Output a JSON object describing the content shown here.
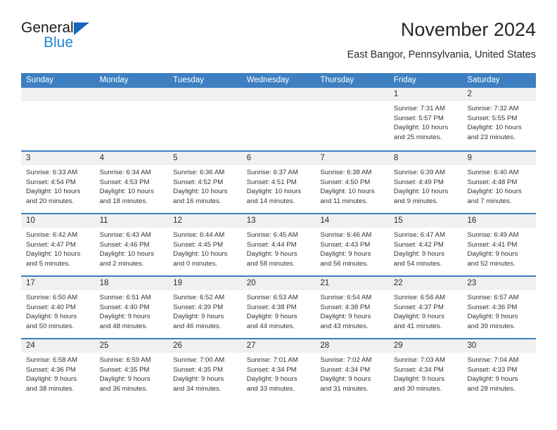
{
  "brand": {
    "name_part1": "General",
    "name_part2": "Blue",
    "triangle_color": "#1567b8",
    "blue_text_color": "#1f86d8"
  },
  "header": {
    "title": "November 2024",
    "subtitle": "East Bangor, Pennsylvania, United States"
  },
  "colors": {
    "header_blue": "#3d7fc1",
    "daynum_band": "#f0f0f0",
    "text": "#333333"
  },
  "weekdays": [
    "Sunday",
    "Monday",
    "Tuesday",
    "Wednesday",
    "Thursday",
    "Friday",
    "Saturday"
  ],
  "weeks": [
    {
      "days": [
        {
          "empty": true
        },
        {
          "empty": true
        },
        {
          "empty": true
        },
        {
          "empty": true
        },
        {
          "empty": true
        },
        {
          "empty": false,
          "num": "1",
          "sunrise": "Sunrise: 7:31 AM",
          "sunset": "Sunset: 5:57 PM",
          "daylight": "Daylight: 10 hours and 25 minutes."
        },
        {
          "empty": false,
          "num": "2",
          "sunrise": "Sunrise: 7:32 AM",
          "sunset": "Sunset: 5:55 PM",
          "daylight": "Daylight: 10 hours and 23 minutes."
        }
      ]
    },
    {
      "days": [
        {
          "empty": false,
          "num": "3",
          "sunrise": "Sunrise: 6:33 AM",
          "sunset": "Sunset: 4:54 PM",
          "daylight": "Daylight: 10 hours and 20 minutes."
        },
        {
          "empty": false,
          "num": "4",
          "sunrise": "Sunrise: 6:34 AM",
          "sunset": "Sunset: 4:53 PM",
          "daylight": "Daylight: 10 hours and 18 minutes."
        },
        {
          "empty": false,
          "num": "5",
          "sunrise": "Sunrise: 6:36 AM",
          "sunset": "Sunset: 4:52 PM",
          "daylight": "Daylight: 10 hours and 16 minutes."
        },
        {
          "empty": false,
          "num": "6",
          "sunrise": "Sunrise: 6:37 AM",
          "sunset": "Sunset: 4:51 PM",
          "daylight": "Daylight: 10 hours and 14 minutes."
        },
        {
          "empty": false,
          "num": "7",
          "sunrise": "Sunrise: 6:38 AM",
          "sunset": "Sunset: 4:50 PM",
          "daylight": "Daylight: 10 hours and 11 minutes."
        },
        {
          "empty": false,
          "num": "8",
          "sunrise": "Sunrise: 6:39 AM",
          "sunset": "Sunset: 4:49 PM",
          "daylight": "Daylight: 10 hours and 9 minutes."
        },
        {
          "empty": false,
          "num": "9",
          "sunrise": "Sunrise: 6:40 AM",
          "sunset": "Sunset: 4:48 PM",
          "daylight": "Daylight: 10 hours and 7 minutes."
        }
      ]
    },
    {
      "days": [
        {
          "empty": false,
          "num": "10",
          "sunrise": "Sunrise: 6:42 AM",
          "sunset": "Sunset: 4:47 PM",
          "daylight": "Daylight: 10 hours and 5 minutes."
        },
        {
          "empty": false,
          "num": "11",
          "sunrise": "Sunrise: 6:43 AM",
          "sunset": "Sunset: 4:46 PM",
          "daylight": "Daylight: 10 hours and 2 minutes."
        },
        {
          "empty": false,
          "num": "12",
          "sunrise": "Sunrise: 6:44 AM",
          "sunset": "Sunset: 4:45 PM",
          "daylight": "Daylight: 10 hours and 0 minutes."
        },
        {
          "empty": false,
          "num": "13",
          "sunrise": "Sunrise: 6:45 AM",
          "sunset": "Sunset: 4:44 PM",
          "daylight": "Daylight: 9 hours and 58 minutes."
        },
        {
          "empty": false,
          "num": "14",
          "sunrise": "Sunrise: 6:46 AM",
          "sunset": "Sunset: 4:43 PM",
          "daylight": "Daylight: 9 hours and 56 minutes."
        },
        {
          "empty": false,
          "num": "15",
          "sunrise": "Sunrise: 6:47 AM",
          "sunset": "Sunset: 4:42 PM",
          "daylight": "Daylight: 9 hours and 54 minutes."
        },
        {
          "empty": false,
          "num": "16",
          "sunrise": "Sunrise: 6:49 AM",
          "sunset": "Sunset: 4:41 PM",
          "daylight": "Daylight: 9 hours and 52 minutes."
        }
      ]
    },
    {
      "days": [
        {
          "empty": false,
          "num": "17",
          "sunrise": "Sunrise: 6:50 AM",
          "sunset": "Sunset: 4:40 PM",
          "daylight": "Daylight: 9 hours and 50 minutes."
        },
        {
          "empty": false,
          "num": "18",
          "sunrise": "Sunrise: 6:51 AM",
          "sunset": "Sunset: 4:40 PM",
          "daylight": "Daylight: 9 hours and 48 minutes."
        },
        {
          "empty": false,
          "num": "19",
          "sunrise": "Sunrise: 6:52 AM",
          "sunset": "Sunset: 4:39 PM",
          "daylight": "Daylight: 9 hours and 46 minutes."
        },
        {
          "empty": false,
          "num": "20",
          "sunrise": "Sunrise: 6:53 AM",
          "sunset": "Sunset: 4:38 PM",
          "daylight": "Daylight: 9 hours and 44 minutes."
        },
        {
          "empty": false,
          "num": "21",
          "sunrise": "Sunrise: 6:54 AM",
          "sunset": "Sunset: 4:38 PM",
          "daylight": "Daylight: 9 hours and 43 minutes."
        },
        {
          "empty": false,
          "num": "22",
          "sunrise": "Sunrise: 6:56 AM",
          "sunset": "Sunset: 4:37 PM",
          "daylight": "Daylight: 9 hours and 41 minutes."
        },
        {
          "empty": false,
          "num": "23",
          "sunrise": "Sunrise: 6:57 AM",
          "sunset": "Sunset: 4:36 PM",
          "daylight": "Daylight: 9 hours and 39 minutes."
        }
      ]
    },
    {
      "days": [
        {
          "empty": false,
          "num": "24",
          "sunrise": "Sunrise: 6:58 AM",
          "sunset": "Sunset: 4:36 PM",
          "daylight": "Daylight: 9 hours and 38 minutes."
        },
        {
          "empty": false,
          "num": "25",
          "sunrise": "Sunrise: 6:59 AM",
          "sunset": "Sunset: 4:35 PM",
          "daylight": "Daylight: 9 hours and 36 minutes."
        },
        {
          "empty": false,
          "num": "26",
          "sunrise": "Sunrise: 7:00 AM",
          "sunset": "Sunset: 4:35 PM",
          "daylight": "Daylight: 9 hours and 34 minutes."
        },
        {
          "empty": false,
          "num": "27",
          "sunrise": "Sunrise: 7:01 AM",
          "sunset": "Sunset: 4:34 PM",
          "daylight": "Daylight: 9 hours and 33 minutes."
        },
        {
          "empty": false,
          "num": "28",
          "sunrise": "Sunrise: 7:02 AM",
          "sunset": "Sunset: 4:34 PM",
          "daylight": "Daylight: 9 hours and 31 minutes."
        },
        {
          "empty": false,
          "num": "29",
          "sunrise": "Sunrise: 7:03 AM",
          "sunset": "Sunset: 4:34 PM",
          "daylight": "Daylight: 9 hours and 30 minutes."
        },
        {
          "empty": false,
          "num": "30",
          "sunrise": "Sunrise: 7:04 AM",
          "sunset": "Sunset: 4:33 PM",
          "daylight": "Daylight: 9 hours and 28 minutes."
        }
      ]
    }
  ]
}
